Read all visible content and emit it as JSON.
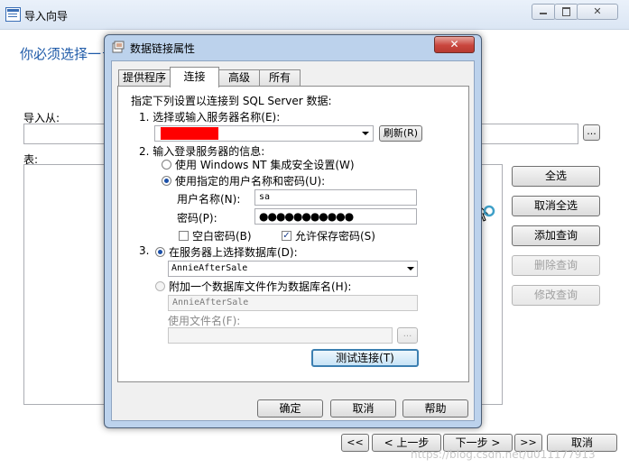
{
  "bg_window": {
    "title": "导入向导",
    "heading": "你必须选择一",
    "import_from_label": "导入从:",
    "table_label": "表:",
    "buttons": {
      "select_all": "全选",
      "deselect_all": "取消全选",
      "add_query": "添加查询",
      "delete_query": "删除查询",
      "modify_query": "修改查询",
      "first": "<<",
      "prev": "< 上一步",
      "next": "下一步 >",
      "last": ">>",
      "cancel": "取消",
      "browse": "..."
    }
  },
  "dialog": {
    "title": "数据链接属性",
    "tabs": [
      "提供程序",
      "连接",
      "高级",
      "所有"
    ],
    "intro": "指定下列设置以连接到 SQL Server 数据:",
    "step1_label": "1. 选择或输入服务器名称(E):",
    "refresh_button": "刷新(R)",
    "step2_label": "2. 输入登录服务器的信息:",
    "radio_nt": "使用 Windows NT 集成安全设置(W)",
    "radio_user": "使用指定的用户名称和密码(U):",
    "username_label": "用户名称(N):",
    "username_value": "sa",
    "password_label": "密码(P):",
    "password_value": "●●●●●●●●●●●",
    "blank_password": "空白密码(B)",
    "allow_save_password": "允许保存密码(S)",
    "step3_label": "3.",
    "radio_select_db": "在服务器上选择数据库(D):",
    "database_value": "AnnieAfterSale",
    "radio_attach": "附加一个数据库文件作为数据库名(H):",
    "attach_value": "AnnieAfterSale",
    "use_filename_label": "使用文件名(F):",
    "browse_button": "...",
    "test_button": "测试连接(T)",
    "ok_button": "确定",
    "cancel_button": "取消",
    "help_button": "帮助"
  },
  "colors": {
    "accent": "#1a4fa8",
    "redacted": "#ff0000",
    "dialog_frame": "#bcd2ec",
    "close_button": "#c9463d"
  },
  "watermark": "https://blog.csdn.net/u011177913"
}
